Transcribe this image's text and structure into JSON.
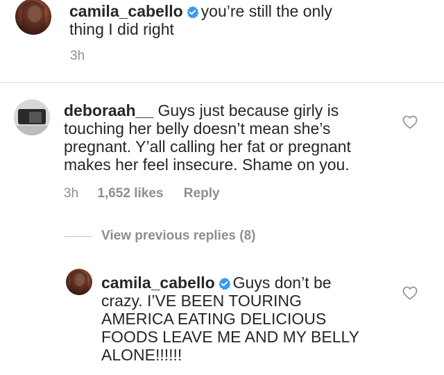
{
  "post_caption": {
    "username": "camila_cabello",
    "verified": true,
    "text_line1": "you’re still the only",
    "text_line2": "thing I did right",
    "time": "3h"
  },
  "comment": {
    "username": "deboraah__",
    "lines": [
      "Guys just because girly is",
      "touching her belly doesn’t mean she’s",
      "pregnant. Y’all calling her fat or pregnant",
      "makes her feel insecure. Shame on you."
    ],
    "time": "3h",
    "likes": "1,652 likes",
    "reply_label": "Reply"
  },
  "view_previous": {
    "label": "View previous replies (8)"
  },
  "reply": {
    "username": "camila_cabello",
    "verified": true,
    "lines": [
      "Guys don’t be",
      "crazy. I’VE BEEN TOURING",
      "AMERICA EATING DELICIOUS",
      "FOODS LEAVE ME AND MY BELLY",
      "ALONE!!!!!!"
    ]
  },
  "icons": {
    "verified": "verified-badge-icon",
    "like": "heart-outline-icon"
  },
  "colors": {
    "text": "#262626",
    "muted": "#8e8e8e",
    "verified_blue": "#3897f0",
    "divider": "#dbdbdb"
  }
}
